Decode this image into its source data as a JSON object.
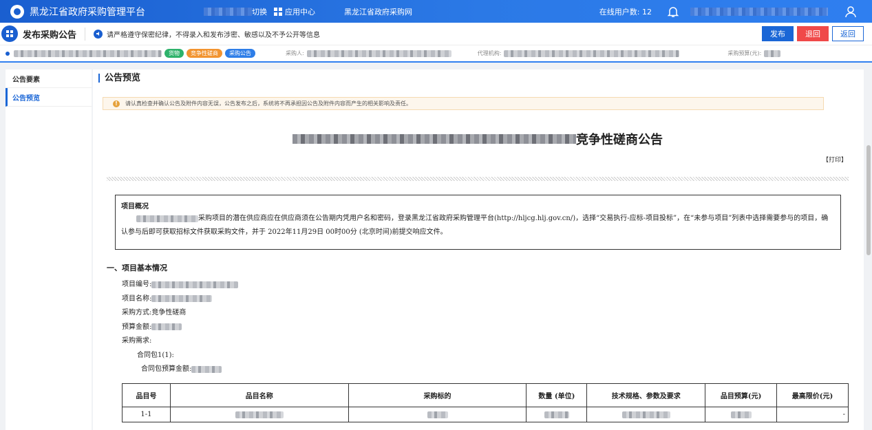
{
  "topbar": {
    "app_title": "黑龙江省政府采购管理平台",
    "switch_label": "切换",
    "apps_label": "应用中心",
    "gov_site": "黑龙江省政府采购网",
    "online_users": "在线用户数: 12"
  },
  "actionbar": {
    "page_title": "发布采购公告",
    "notice": "请严格遵守保密纪律，不得录入和发布涉密、敏感以及不予公开等信息",
    "publish": "发布",
    "reject": "退回",
    "back": "返回"
  },
  "infobar": {
    "tags": [
      "货物",
      "竞争性磋商",
      "采购公告"
    ],
    "purchaser_label": "采购人:",
    "agency_label": "代理机构:",
    "budget_label": "采购预算(元):"
  },
  "sidebar": {
    "items": [
      "公告要素",
      "公告预览"
    ]
  },
  "main": {
    "section_title": "公告预览",
    "warning": "请认真检查并确认公告及附件内容无误，公告发布之后，系统将不再承担因公告及附件内容而产生的相关影响及责任。",
    "doc_title_suffix": "竞争性磋商公告",
    "print": "【打印】",
    "overview": {
      "title": "项目概况",
      "text": "采购项目的潜在供应商应在供应商须在公告期内凭用户名和密码，登录黑龙江省政府采购管理平台(http://hljcg.hlj.gov.cn/)，选择“交易执行-应标-项目投标”，在“未参与项目”列表中选择需要参与的项目，确认参与后即可获取招标文件获取采购文件，并于 2022年11月29日 00时00分 (北京时间)前提交响应文件。"
    },
    "section1": "一、项目基本情况",
    "fields": {
      "project_no": "项目编号:",
      "project_name": "项目名称:",
      "method": "采购方式:",
      "method_value": "竞争性磋商",
      "budget": "预算金额:",
      "requirement": "采购需求:",
      "contract_pkg": "合同包1(1):",
      "pkg_budget": "合同包预算金额:"
    },
    "table": {
      "headers": [
        "品目号",
        "品目名称",
        "采购标的",
        "数量 (单位)",
        "技术规格、参数及要求",
        "品目预算(元)",
        "最高限价(元)"
      ],
      "rows": [
        [
          "1-1",
          "",
          "",
          "",
          "",
          "",
          "-"
        ]
      ]
    }
  },
  "colors": {
    "primary": "#1a66d6",
    "danger": "#f04949",
    "tag_green": "#2eb26b",
    "tag_orange": "#f29430",
    "tag_blue": "#2e7ee8"
  }
}
